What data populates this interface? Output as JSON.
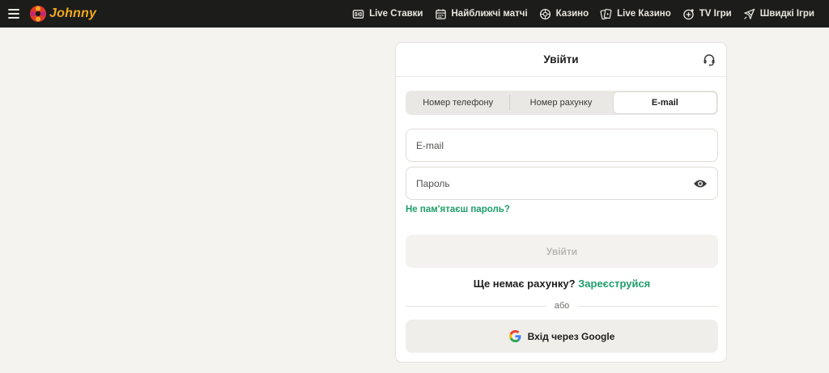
{
  "header": {
    "logo_text": "Johnny",
    "nav": [
      {
        "label": "Live Ставки",
        "icon": "scoreboard-icon"
      },
      {
        "label": "Найближчі матчі",
        "icon": "calendar-icon"
      },
      {
        "label": "Казино",
        "icon": "roulette-icon"
      },
      {
        "label": "Live Казино",
        "icon": "cards-icon"
      },
      {
        "label": "TV Ігри",
        "icon": "tv-plus-icon"
      },
      {
        "label": "Швидкі Ігри",
        "icon": "rocket-icon"
      }
    ]
  },
  "login": {
    "title": "Увійти",
    "tabs": [
      {
        "label": "Номер телефону",
        "active": false
      },
      {
        "label": "Номер рахунку",
        "active": false
      },
      {
        "label": "E-mail",
        "active": true
      }
    ],
    "email_placeholder": "E-mail",
    "password_placeholder": "Пароль",
    "forgot_link": "Не пам'ятаєш пароль?",
    "submit_label": "Увійти",
    "no_account_text": "Ще немає рахунку?",
    "register_link": "Зареєструйся",
    "divider_text": "або",
    "google_label": "Вхід через Google"
  },
  "colors": {
    "accent_green": "#1e9e6a",
    "header_bg": "#1c1c1a",
    "logo_orange": "#f0a820",
    "page_bg": "#f4f3f0"
  }
}
